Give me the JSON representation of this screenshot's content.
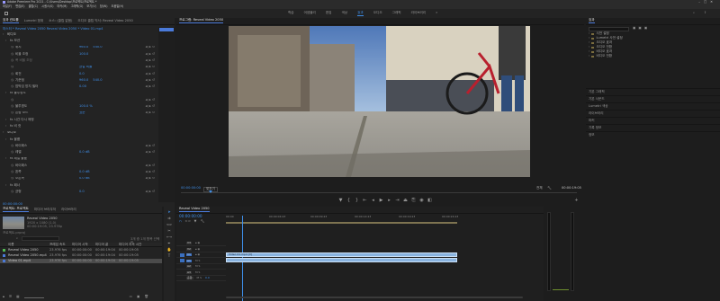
{
  "title_bar": {
    "title": "Adobe Premiere Pro 2021 - C:\\Users\\Desktop\\프로젝트\\프로젝트 *"
  },
  "menu": [
    "파일(F)",
    "편집(E)",
    "클립(C)",
    "시퀀스(S)",
    "마커(M)",
    "그래픽(G)",
    "보기(V)",
    "창(W)",
    "도움말(H)"
  ],
  "workspaces": [
    "학습",
    "어셈블리",
    "편집",
    "색상",
    "효과",
    "오디오",
    "그래픽",
    "라이브러리"
  ],
  "workspace_active": "효과",
  "effect_controls": {
    "tabs": [
      "효과 컨트롤",
      "Lumetri 범위",
      "소스: (클립 없음)",
      "오디오 클립 믹서: Reveal Video 2050"
    ],
    "clip_header": "마스터 * Reveal Video 2050  Reveal Video 2050 * Video 01.mp4",
    "rows": [
      {
        "name": "비디오",
        "kind": "section"
      },
      {
        "name": "fx  모션",
        "kind": "group"
      },
      {
        "name": "위치",
        "vals": [
          "960.0",
          "540.0"
        ]
      },
      {
        "name": "비율 조정",
        "vals": [
          "100.0"
        ]
      },
      {
        "name": "폭 비율 조정",
        "vals": [],
        "dim": true
      },
      {
        "name": "",
        "vals": [
          "균일 비율"
        ]
      },
      {
        "name": "회전",
        "vals": [
          "0.0"
        ]
      },
      {
        "name": "기준점",
        "vals": [
          "960.0",
          "540.0"
        ]
      },
      {
        "name": "깜박임 방지 필터",
        "vals": [
          "0.00"
        ]
      },
      {
        "name": "fx  불투명도",
        "kind": "group"
      },
      {
        "name": "",
        "vals": []
      },
      {
        "name": "불투명도",
        "vals": [
          "100.0 %"
        ]
      },
      {
        "name": "혼합 모드",
        "vals": [
          "표준"
        ]
      },
      {
        "name": "fx  시간 다시 매핑",
        "kind": "group"
      },
      {
        "name": "fx  비 컷",
        "kind": "group"
      },
      {
        "name": "오디오",
        "kind": "section"
      },
      {
        "name": "fx  볼륨",
        "kind": "group"
      },
      {
        "name": "바이패스",
        "vals": []
      },
      {
        "name": "레벨",
        "vals": [
          "0.0 dB"
        ]
      },
      {
        "name": "fx  채널 볼륨",
        "kind": "group"
      },
      {
        "name": "바이패스",
        "vals": []
      },
      {
        "name": "왼쪽",
        "vals": [
          "0.0 dB"
        ]
      },
      {
        "name": "오른쪽",
        "vals": [
          "0.0 dB"
        ]
      },
      {
        "name": "fx  패너",
        "kind": "group"
      },
      {
        "name": "균형",
        "vals": [
          "0.0"
        ]
      }
    ],
    "timecode": "00:00:00:00"
  },
  "program_monitor": {
    "tab": "프로그램: Reveal Video 2050",
    "timecode_left": "00:00:00:00",
    "fit": "맞추기",
    "quality": "전체",
    "timecode_right": "00:00:19:05"
  },
  "project": {
    "tabs": [
      "프로젝트: 프로젝트",
      "미디어 브라우저",
      "라이브러리"
    ],
    "file_name": "프로젝트.prproj",
    "selected_item": "Reveal Video 2050",
    "item_detail": "1920 x 1080 (1.0)",
    "item_fps": "00:00:19:05, 23.976p",
    "count_label": "3개 중 1개 항목 선택됨",
    "columns": [
      "이름",
      "프레임 속도",
      "미디어 시작",
      "미디어 끝",
      "미디어 지속 시간"
    ],
    "items": [
      {
        "name": "Reveal Video 2050",
        "fps": "23.976 fps",
        "start": "00:00:00:00",
        "end": "00:00:19:04",
        "dur": "00:00:19:05",
        "color": "#53b853",
        "selected": false
      },
      {
        "name": "Reveal Video 2050.mp4",
        "fps": "23.976 fps",
        "start": "00:00:00:00",
        "end": "00:00:19:04",
        "dur": "00:00:19:05",
        "color": "#4a7ad9",
        "selected": false
      },
      {
        "name": "Video 01.mp4",
        "fps": "23.976 fps",
        "start": "00:00:00:00",
        "end": "00:00:19:04",
        "dur": "00:00:19:05",
        "color": "#4a7ad9",
        "selected": true
      }
    ]
  },
  "tools": [
    "selection",
    "track-select",
    "ripple",
    "razor",
    "slip",
    "pen",
    "hand",
    "type"
  ],
  "timeline": {
    "tab": "Reveal Video 2050",
    "timecode": "00:00:00:00",
    "ruler": [
      "00:00",
      "00:00:04:23",
      "00:00:09:23",
      "00:00:14:23",
      "00:00:19:23",
      "00:00:24:23"
    ],
    "tracks": [
      "V3",
      "V2",
      "V1",
      "A1",
      "A2",
      "A3",
      "혼합"
    ],
    "mix_value": "0.0",
    "clip_video": "Video 01.mp4 [V]"
  },
  "effects_panel": {
    "title": "효과",
    "tree": [
      "사전 설정",
      "Lumetri 사전 설정",
      "오디오 효과",
      "오디오 전환",
      "비디오 효과",
      "비디오 전환"
    ],
    "sections": [
      "기본 그래픽",
      "기본 사운드",
      "Lumetri 색상",
      "라이브러리",
      "마커",
      "기록 정보",
      "정보"
    ]
  }
}
